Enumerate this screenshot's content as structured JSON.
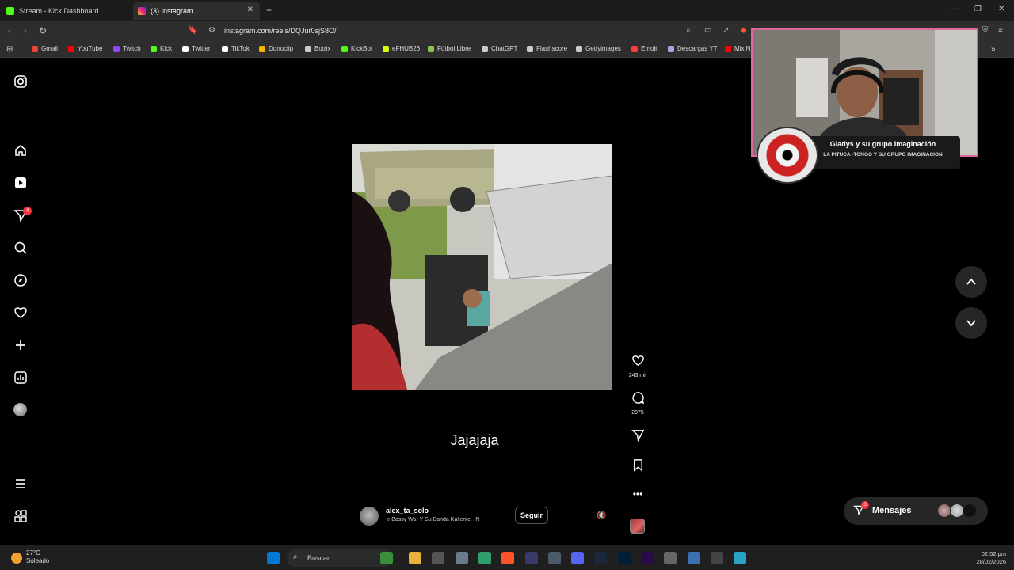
{
  "browser": {
    "tabs": [
      {
        "title": "Stream - Kick Dashboard",
        "active": false
      },
      {
        "title": "(3) Instagram",
        "active": true
      }
    ],
    "url": "instagram.com/reels/DQJur0sjS8O/",
    "bookmarks": [
      {
        "label": "Gmail",
        "color": "#ea4335"
      },
      {
        "label": "YouTube",
        "color": "#ff0000"
      },
      {
        "label": "Twitch",
        "color": "#9146ff"
      },
      {
        "label": "Kick",
        "color": "#53fc18"
      },
      {
        "label": "Twitter",
        "color": "#ffffff"
      },
      {
        "label": "TikTok",
        "color": "#ffffff"
      },
      {
        "label": "Donoclip",
        "color": "#f7b500"
      },
      {
        "label": "Botrix",
        "color": "#cccccc"
      },
      {
        "label": "KickBot",
        "color": "#53fc18"
      },
      {
        "label": "eFHUB26",
        "color": "#d4ff00"
      },
      {
        "label": "Fútbol Libre",
        "color": "#8bc34a"
      },
      {
        "label": "ChatGPT",
        "color": "#cccccc"
      },
      {
        "label": "Flashscore",
        "color": "#cccccc"
      },
      {
        "label": "Gettyimages",
        "color": "#cccccc"
      },
      {
        "label": "Emoji",
        "color": "#ff3b3b"
      },
      {
        "label": "Descargas YT",
        "color": "#b39ddb"
      },
      {
        "label": "Mix N",
        "color": "#ff0000"
      }
    ]
  },
  "instagram": {
    "notifications_badge": "4",
    "reel": {
      "caption": "Jajajaja",
      "username": "alex_ta_solo",
      "audio": "♫  Bossy War Y Su Banda Kaliente - N",
      "follow_label": "Seguir",
      "likes": "243 mil",
      "comments": "2975"
    },
    "messages": {
      "label": "Mensajes",
      "badge": "3"
    }
  },
  "overlay": {
    "now_playing_title": "Gladys y su grupo Imaginación",
    "now_playing_subtitle": "LA PITUCA -TONGO Y SU GRUPO IMAGINACION"
  },
  "taskbar": {
    "temperature": "27°C",
    "condition": "Soleado",
    "search_placeholder": "Buscar",
    "time": "02:52 pm",
    "date": "28/02/2026"
  }
}
